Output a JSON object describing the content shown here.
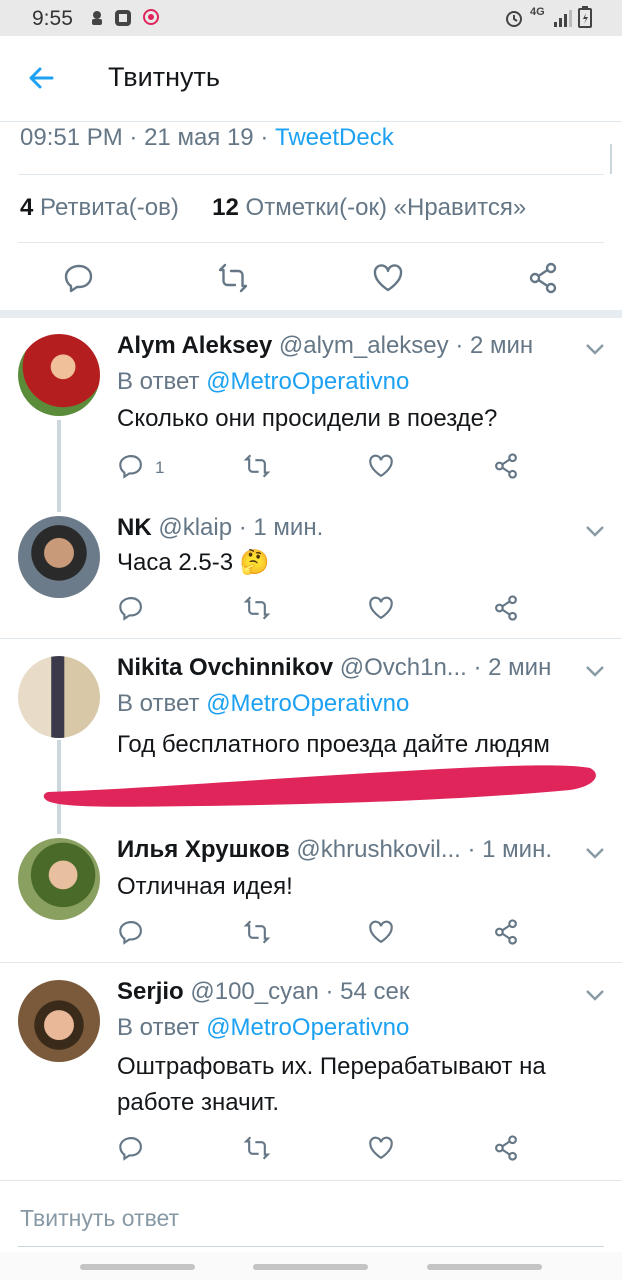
{
  "status_bar": {
    "time": "9:55",
    "network": "4G"
  },
  "app_bar": {
    "title": "Твитнуть",
    "back_icon": "arrow-left-icon"
  },
  "tweet_meta": {
    "time": "09:51 PM",
    "sep1": "·",
    "date": "21 мая 19",
    "sep2": "·",
    "source": "TweetDeck"
  },
  "tweet_stats": {
    "retweets_count": "4",
    "retweets_label": "Ретвита(-ов)",
    "likes_count": "12",
    "likes_label": "Отметки(-ок) «Нравится»"
  },
  "replies": [
    {
      "name": "Alym Aleksey",
      "handle": "@alym_aleksey",
      "time": "· 2 мин",
      "reply_prefix": "В ответ",
      "reply_to": "@MetroOperativno",
      "text": "Сколько они просидели в поезде?",
      "reply_count": "1"
    },
    {
      "name": "NK",
      "handle": "@klaip",
      "time": "· 1 мин.",
      "text": "Часа 2.5-3 🤔"
    },
    {
      "name": "Nikita Ovchinnikov",
      "handle": "@Ovch1n...",
      "time": "· 2 мин",
      "reply_prefix": "В ответ",
      "reply_to": "@MetroOperativno",
      "text": "Год бесплатного проезда дайте людям"
    },
    {
      "name": "Илья Хрушков",
      "handle": "@khrushkovil...",
      "time": "· 1 мин.",
      "text": "Отличная идея!"
    },
    {
      "name": "Serjio",
      "handle": "@100_cyan",
      "time": "· 54 сек",
      "reply_prefix": "В ответ",
      "reply_to": "@MetroOperativno",
      "text_line1": "Оштрафовать их. Перерабатывают на",
      "text_line2": "работе значит."
    }
  ],
  "reply_box": {
    "placeholder": "Твитнуть ответ"
  },
  "colors": {
    "accent": "#1da1f2",
    "secondary_text": "#657786",
    "divider": "#e1e8ed",
    "redaction": "#e0255a"
  }
}
